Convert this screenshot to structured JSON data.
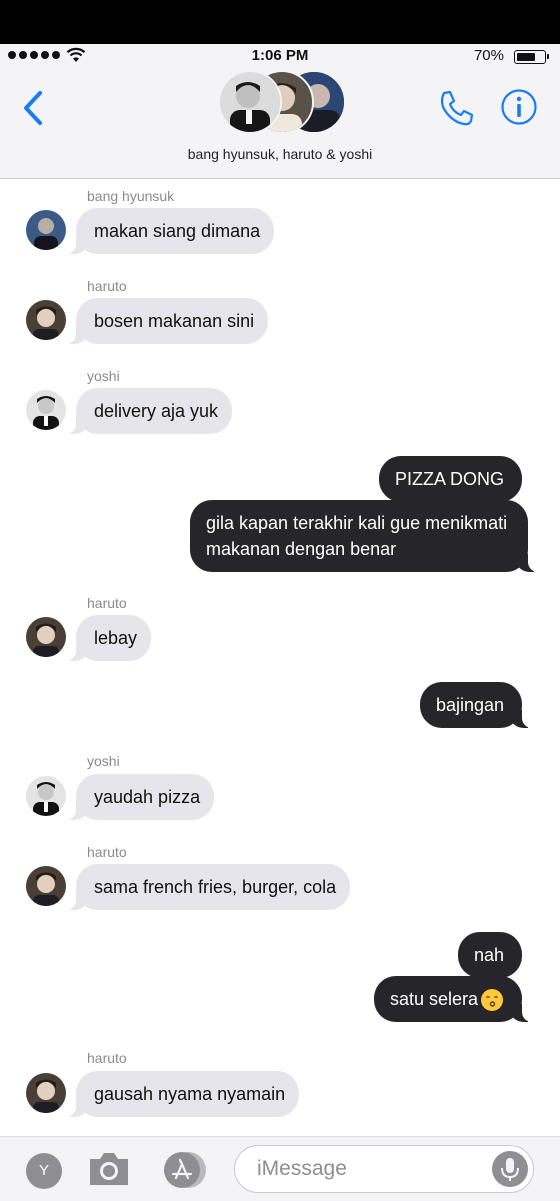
{
  "status_bar": {
    "time": "1:06 PM",
    "battery": "70%",
    "battery_level": 0.7
  },
  "header": {
    "group_name": "bang hyunsuk, haruto & yoshi",
    "icons": [
      "back-chevron-icon",
      "phone-icon",
      "info-icon"
    ]
  },
  "messages": [
    {
      "sender": "bang hyunsuk",
      "text": "makan siang dimana"
    },
    {
      "sender": "haruto",
      "text": "bosen makanan sini"
    },
    {
      "sender": "yoshi",
      "text": "delivery aja yuk"
    },
    {
      "text": "PIZZA DONG"
    },
    {
      "text": "gila kapan terakhir kali gue menikmati makanan dengan benar"
    },
    {
      "sender": "haruto",
      "text": "lebay"
    },
    {
      "text": "bajingan"
    },
    {
      "sender": "yoshi",
      "text": "yaudah pizza"
    },
    {
      "sender": "haruto",
      "text": "sama french fries, burger, cola"
    },
    {
      "text": "nah"
    },
    {
      "text": "satu selera",
      "emoji": "kissing-face-emoji"
    },
    {
      "sender": "haruto",
      "text": "gausah nyama nyamain"
    }
  ],
  "input_bar": {
    "app_label": "Y",
    "placeholder": "iMessage",
    "icons": [
      "camera-icon",
      "app-store-icon",
      "microphone-icon"
    ]
  },
  "colors": {
    "accent": "#1a7cf5",
    "incoming_bubble": "#e6e5eb",
    "outgoing_bubble": "#26262a"
  }
}
